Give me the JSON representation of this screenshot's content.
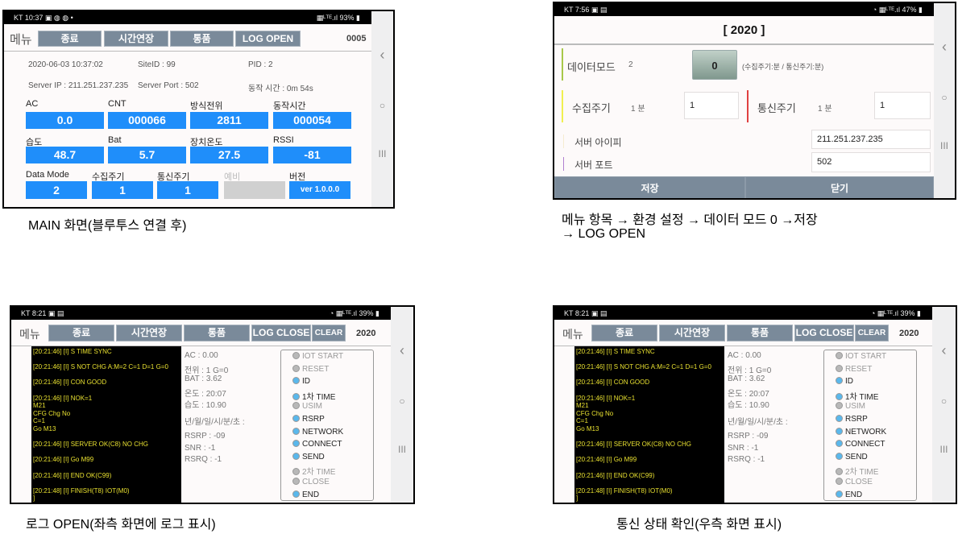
{
  "main_screen": {
    "status_left": "KT 10:37 ▣ ◍ ◍ •",
    "status_right": "▦ᴸᵀᴱ.ıl 93% ▮",
    "menu_label": "메뉴",
    "buttons": [
      "종료",
      "시간연장",
      "통품",
      "LOG OPEN"
    ],
    "code": "0005",
    "datetime": "2020-06-03 10:37:02",
    "site_id": "SiteID : 99",
    "pid": "PID : 2",
    "server_ip": "Server IP : 211.251.237.235",
    "server_port": "Server Port : 502",
    "run_time": "동작 시간 : 0m 54s",
    "row1": [
      {
        "label": "AC",
        "value": "0.0"
      },
      {
        "label": "CNT",
        "value": "000066"
      },
      {
        "label": "방식전위",
        "value": "2811"
      },
      {
        "label": "동작시간",
        "value": "000054"
      }
    ],
    "row2": [
      {
        "label": "습도",
        "value": "48.7"
      },
      {
        "label": "Bat",
        "value": "5.7"
      },
      {
        "label": "장치온도",
        "value": "27.5"
      },
      {
        "label": "RSSI",
        "value": "-81"
      }
    ],
    "row3": [
      {
        "label": "Data Mode",
        "value": "2"
      },
      {
        "label": "수집주기",
        "value": "1"
      },
      {
        "label": "통신주기",
        "value": "1"
      },
      {
        "label": "예비",
        "value": ""
      },
      {
        "label": "버전",
        "value": "ver 1.0.0.0"
      }
    ],
    "caption": "MAIN 화면(블루투스 연결 후)"
  },
  "settings_screen": {
    "status_left": "KT 7:56 ▣ ▤",
    "status_right": "◔ ▦ᴸᵀᴱ.ıl 47% ▮",
    "title": "[ 2020 ]",
    "data_mode_label": "데이터모드",
    "data_mode_current": "2",
    "data_mode_button": "0",
    "data_mode_note": "(수집주기:분 / 통신주기:분)",
    "collect_label": "수집주기",
    "collect_current": "1   분",
    "collect_value": "1",
    "comm_label": "통신주기",
    "comm_current": "1   분",
    "comm_value": "1",
    "server_ip_label": "서버 아이피",
    "server_ip_value": "211.251.237.235",
    "server_port_label": "서버 포트",
    "server_port_value": "502",
    "save_button": "저장",
    "close_button": "닫기",
    "caption_line1": "메뉴 항목 → 환경 설정  →  데이터 모드 0 →저장",
    "caption_line2": "→ LOG OPEN"
  },
  "log_screen": {
    "status_left": "KT 8:21 ▣ ▤",
    "status_right": "◔ ▦ᴸᵀᴱ.ıl 39% ▮",
    "menu_label": "메뉴",
    "buttons": [
      "종료",
      "시간연장",
      "통품",
      "LOG CLOSE",
      "CLEAR"
    ],
    "code": "2020",
    "log_lines": [
      " [20:21:46] [I] S TIME SYNC",
      "",
      " [20:21:46] [I] S NOT CHG A:M=2 C=1 D=1 G=0",
      "",
      " [20:21:46] [I] CON GOOD",
      "",
      " [20:21:46] [I] NOK=1",
      "M21",
      "CFG Chg No",
      "C=1",
      "Go M13",
      "",
      " [20:21:46] [I] SERVER OK(C8) NO CHG",
      "",
      " [20:21:46] [I] Go M99",
      "",
      " [20:21:46] [I] END OK(C99)",
      "",
      " [20:21:48] [I] FINISH(T8) IOT(M0)",
      "]"
    ],
    "stats": [
      "AC :  0.00",
      "전위 : 1 G=0",
      "BAT :  3.62",
      "온도 : 20:07",
      "습도 : 10.90"
    ],
    "datetime_label": "년/월/일/시/분/초 :",
    "signal": [
      "RSRP : -09",
      "SNR :  -1",
      "RSRQ :  -1"
    ],
    "steps": [
      {
        "label": "IOT START",
        "active": false
      },
      {
        "label": "RESET",
        "active": false
      },
      {
        "label": "ID",
        "active": true
      },
      {
        "label": "1차 TIME",
        "active": true
      },
      {
        "label": "USIM",
        "active": false
      },
      {
        "label": "RSRP",
        "active": true
      },
      {
        "label": "NETWORK",
        "active": true
      },
      {
        "label": "CONNECT",
        "active": true
      },
      {
        "label": "SEND",
        "active": true
      },
      {
        "label": "2차 TIME",
        "active": false
      },
      {
        "label": "CLOSE",
        "active": false
      },
      {
        "label": "END",
        "active": true
      }
    ],
    "caption": "로그 OPEN(좌측 화면에 로그 표시)"
  },
  "status_screen": {
    "status_left": "KT 8:21 ▣ ▤",
    "status_right": "◔ ▦ᴸᵀᴱ.ıl 39% ▮",
    "menu_label": "메뉴",
    "buttons": [
      "종료",
      "시간연장",
      "통품",
      "LOG CLOSE",
      "CLEAR"
    ],
    "code": "2020",
    "log_lines": [
      " [20:21:46] [I] S TIME SYNC",
      "",
      " [20:21:46] [I] S NOT CHG A:M=2 C=1 D=1 G=0",
      "",
      " [20:21:46] [I] CON GOOD",
      "",
      " [20:21:46] [I] NOK=1",
      "M21",
      "CFG Chg No",
      "C=1",
      "Go M13",
      "",
      " [20:21:46] [I] SERVER OK(C8) NO CHG",
      "",
      " [20:21:46] [I] Go M99",
      "",
      " [20:21:46] [I] END OK(C99)",
      "",
      " [20:21:48] [I] FINISH(T8) IOT(M0)",
      "]"
    ],
    "stats": [
      "AC :  0.00",
      "전위 : 1 G=0",
      "BAT :  3.62",
      "온도 : 20:07",
      "습도 : 10.90"
    ],
    "datetime_label": "년/월/일/시/분/초 :",
    "signal": [
      "RSRP : -09",
      "SNR :  -1",
      "RSRQ :  -1"
    ],
    "steps": [
      {
        "label": "IOT START",
        "active": false
      },
      {
        "label": "RESET",
        "active": false
      },
      {
        "label": "ID",
        "active": true
      },
      {
        "label": "1차 TIME",
        "active": true
      },
      {
        "label": "USIM",
        "active": false
      },
      {
        "label": "RSRP",
        "active": true
      },
      {
        "label": "NETWORK",
        "active": true
      },
      {
        "label": "CONNECT",
        "active": true
      },
      {
        "label": "SEND",
        "active": true
      },
      {
        "label": "2차 TIME",
        "active": false
      },
      {
        "label": "CLOSE",
        "active": false
      },
      {
        "label": "END",
        "active": true
      }
    ],
    "caption": "통신 상태 확인(우측 화면 표시)"
  },
  "colors": {
    "value_box": "#1f8efa",
    "button": "#7a8a9a",
    "active_dot": "#5ab8ec",
    "inactive_dot": "#b8b8b8",
    "log_text": "#e8e030"
  },
  "icons": {
    "nav": [
      "back-icon",
      "home-icon",
      "recent-apps-icon"
    ]
  }
}
